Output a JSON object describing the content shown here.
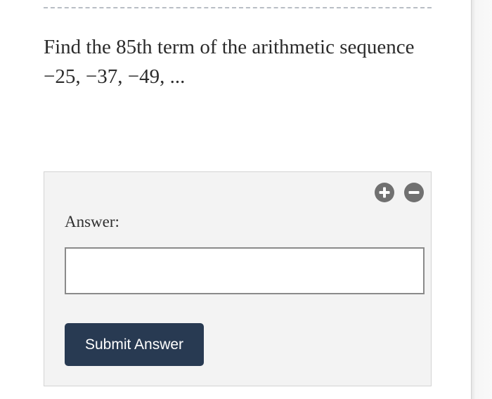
{
  "question": {
    "text": "Find the 85th term of the arithmetic sequence −25, −37, −49, ..."
  },
  "answer_panel": {
    "add_button_icon": "plus-icon",
    "remove_button_icon": "minus-icon",
    "label": "Answer:",
    "input_value": "",
    "input_placeholder": "",
    "submit_label": "Submit Answer"
  },
  "colors": {
    "submit_button_bg": "#283a52",
    "panel_bg": "#f3f3f3",
    "icon_button_bg": "#707070"
  }
}
